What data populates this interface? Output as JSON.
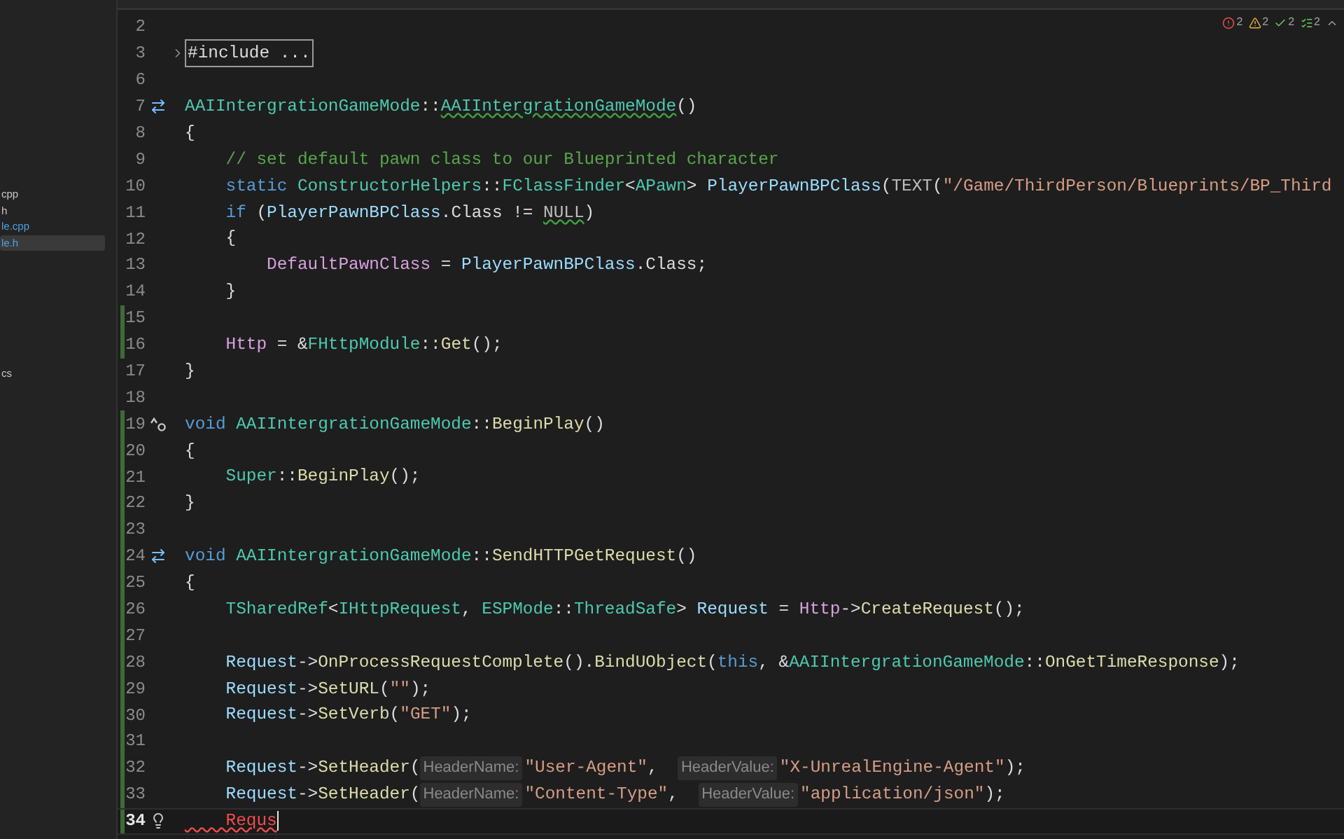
{
  "sidebar": {
    "items": [
      {
        "label": "cpp",
        "selected": false,
        "color": "#c8c8c8"
      },
      {
        "label": "h",
        "selected": false,
        "color": "#c8c8c8"
      },
      {
        "label": "le.cpp",
        "selected": false,
        "color": "#4fa3e0"
      },
      {
        "label": "le.h",
        "selected": true,
        "color": "#4fa3e0"
      }
    ],
    "lower_items": [
      {
        "label": "cs",
        "selected": false,
        "color": "#c8c8c8"
      }
    ]
  },
  "problems": [
    {
      "kind": "error",
      "count": "2"
    },
    {
      "kind": "warning",
      "count": "2"
    },
    {
      "kind": "check",
      "count": "2"
    },
    {
      "kind": "list-check",
      "count": "2"
    }
  ],
  "lines": [
    {
      "number": "2",
      "kind": "plain",
      "changed": false,
      "current": false
    },
    {
      "number": "3",
      "kind": "fold",
      "changed": false,
      "current": false,
      "tokens": [
        {
          "kind": "collapsed",
          "text": "#include ..."
        }
      ]
    },
    {
      "number": "6",
      "kind": "plain",
      "changed": false,
      "current": false
    },
    {
      "number": "7",
      "kind": "override",
      "changed": false,
      "current": false,
      "tokens": [
        {
          "kind": "type",
          "text": "AAIIntergrationGameMode"
        },
        {
          "kind": "plain",
          "text": "::"
        },
        {
          "kind": "type-warning",
          "text": "AAIIntergrationGameMode"
        },
        {
          "kind": "plain",
          "text": "()"
        }
      ]
    },
    {
      "number": "8",
      "kind": "plain",
      "changed": false,
      "current": false,
      "tokens": [
        {
          "kind": "plain",
          "text": "{"
        }
      ]
    },
    {
      "number": "9",
      "kind": "plain",
      "changed": false,
      "current": false,
      "tokens": [
        {
          "kind": "comment",
          "text": "    // set default pawn class to our Blueprinted character"
        }
      ]
    },
    {
      "number": "10",
      "kind": "plain",
      "changed": false,
      "current": false,
      "tokens": [
        {
          "kind": "keyword",
          "text": "    static"
        },
        {
          "kind": "type",
          "text": " ConstructorHelpers"
        },
        {
          "kind": "plain",
          "text": "::"
        },
        {
          "kind": "type",
          "text": "FClassFinder"
        },
        {
          "kind": "plain",
          "text": "<"
        },
        {
          "kind": "type",
          "text": "APawn"
        },
        {
          "kind": "plain",
          "text": "> "
        },
        {
          "kind": "variable",
          "text": "PlayerPawnBPClass"
        },
        {
          "kind": "plain",
          "text": "("
        },
        {
          "kind": "macro",
          "text": "TEXT"
        },
        {
          "kind": "plain",
          "text": "("
        },
        {
          "kind": "string",
          "text": "\"/Game/ThirdPerson/Blueprints/BP_Third"
        }
      ]
    },
    {
      "number": "11",
      "kind": "plain",
      "changed": false,
      "current": false,
      "tokens": [
        {
          "kind": "keyword",
          "text": "    if"
        },
        {
          "kind": "plain",
          "text": " ("
        },
        {
          "kind": "variable",
          "text": "PlayerPawnBPClass"
        },
        {
          "kind": "plain",
          "text": ".Class != "
        },
        {
          "kind": "macro-warning",
          "text": "NULL"
        },
        {
          "kind": "plain",
          "text": ")"
        }
      ]
    },
    {
      "number": "12",
      "kind": "plain",
      "changed": false,
      "current": false,
      "tokens": [
        {
          "kind": "plain",
          "text": "    {"
        }
      ]
    },
    {
      "number": "13",
      "kind": "plain",
      "changed": false,
      "current": false,
      "tokens": [
        {
          "kind": "member",
          "text": "        DefaultPawnClass"
        },
        {
          "kind": "plain",
          "text": " = "
        },
        {
          "kind": "variable",
          "text": "PlayerPawnBPClass"
        },
        {
          "kind": "plain",
          "text": ".Class;"
        }
      ]
    },
    {
      "number": "14",
      "kind": "plain",
      "changed": false,
      "current": false,
      "tokens": [
        {
          "kind": "plain",
          "text": "    }"
        }
      ]
    },
    {
      "number": "15",
      "kind": "plain",
      "changed": true,
      "current": false
    },
    {
      "number": "16",
      "kind": "plain",
      "changed": true,
      "current": false,
      "tokens": [
        {
          "kind": "member",
          "text": "    Http"
        },
        {
          "kind": "plain",
          "text": " = &"
        },
        {
          "kind": "type",
          "text": "FHttpModule"
        },
        {
          "kind": "plain",
          "text": "::"
        },
        {
          "kind": "function",
          "text": "Get"
        },
        {
          "kind": "plain",
          "text": "();"
        }
      ]
    },
    {
      "number": "17",
      "kind": "plain",
      "changed": false,
      "current": false,
      "tokens": [
        {
          "kind": "plain",
          "text": "}"
        }
      ]
    },
    {
      "number": "18",
      "kind": "plain",
      "changed": false,
      "current": false
    },
    {
      "number": "19",
      "kind": "base",
      "changed": true,
      "current": false,
      "tokens": [
        {
          "kind": "keyword",
          "text": "void"
        },
        {
          "kind": "type",
          "text": " AAIIntergrationGameMode"
        },
        {
          "kind": "plain",
          "text": "::"
        },
        {
          "kind": "function",
          "text": "BeginPlay"
        },
        {
          "kind": "plain",
          "text": "()"
        }
      ]
    },
    {
      "number": "20",
      "kind": "plain",
      "changed": true,
      "current": false,
      "tokens": [
        {
          "kind": "plain",
          "text": "{"
        }
      ]
    },
    {
      "number": "21",
      "kind": "plain",
      "changed": true,
      "current": false,
      "tokens": [
        {
          "kind": "type",
          "text": "    Super"
        },
        {
          "kind": "plain",
          "text": "::"
        },
        {
          "kind": "function",
          "text": "BeginPlay"
        },
        {
          "kind": "plain",
          "text": "();"
        }
      ]
    },
    {
      "number": "22",
      "kind": "plain",
      "changed": true,
      "current": false,
      "tokens": [
        {
          "kind": "plain",
          "text": "}"
        }
      ]
    },
    {
      "number": "23",
      "kind": "plain",
      "changed": true,
      "current": false
    },
    {
      "number": "24",
      "kind": "override",
      "changed": true,
      "current": false,
      "tokens": [
        {
          "kind": "keyword",
          "text": "void"
        },
        {
          "kind": "type",
          "text": " AAIIntergrationGameMode"
        },
        {
          "kind": "plain",
          "text": "::"
        },
        {
          "kind": "function",
          "text": "SendHTTPGetRequest"
        },
        {
          "kind": "plain",
          "text": "()"
        }
      ]
    },
    {
      "number": "25",
      "kind": "plain",
      "changed": true,
      "current": false,
      "tokens": [
        {
          "kind": "plain",
          "text": "{"
        }
      ]
    },
    {
      "number": "26",
      "kind": "plain",
      "changed": true,
      "current": false,
      "tokens": [
        {
          "kind": "type",
          "text": "    TSharedRef"
        },
        {
          "kind": "plain",
          "text": "<"
        },
        {
          "kind": "type",
          "text": "IHttpRequest"
        },
        {
          "kind": "plain",
          "text": ", "
        },
        {
          "kind": "type",
          "text": "ESPMode"
        },
        {
          "kind": "plain",
          "text": "::"
        },
        {
          "kind": "type",
          "text": "ThreadSafe"
        },
        {
          "kind": "plain",
          "text": "> "
        },
        {
          "kind": "variable",
          "text": "Request"
        },
        {
          "kind": "plain",
          "text": " = "
        },
        {
          "kind": "member",
          "text": "Http"
        },
        {
          "kind": "plain",
          "text": "->"
        },
        {
          "kind": "function",
          "text": "CreateRequest"
        },
        {
          "kind": "plain",
          "text": "();"
        }
      ]
    },
    {
      "number": "27",
      "kind": "plain",
      "changed": true,
      "current": false
    },
    {
      "number": "28",
      "kind": "plain",
      "changed": true,
      "current": false,
      "tokens": [
        {
          "kind": "variable",
          "text": "    Request"
        },
        {
          "kind": "plain",
          "text": "->"
        },
        {
          "kind": "function",
          "text": "OnProcessRequestComplete"
        },
        {
          "kind": "plain",
          "text": "()."
        },
        {
          "kind": "function",
          "text": "BindUObject"
        },
        {
          "kind": "plain",
          "text": "("
        },
        {
          "kind": "keyword",
          "text": "this"
        },
        {
          "kind": "plain",
          "text": ", &"
        },
        {
          "kind": "type",
          "text": "AAIIntergrationGameMode"
        },
        {
          "kind": "plain",
          "text": "::"
        },
        {
          "kind": "function",
          "text": "OnGetTimeResponse"
        },
        {
          "kind": "plain",
          "text": ");"
        }
      ]
    },
    {
      "number": "29",
      "kind": "plain",
      "changed": true,
      "current": false,
      "tokens": [
        {
          "kind": "variable",
          "text": "    Request"
        },
        {
          "kind": "plain",
          "text": "->"
        },
        {
          "kind": "function",
          "text": "SetURL"
        },
        {
          "kind": "plain",
          "text": "("
        },
        {
          "kind": "string",
          "text": "\"\""
        },
        {
          "kind": "plain",
          "text": ");"
        }
      ]
    },
    {
      "number": "30",
      "kind": "plain",
      "changed": true,
      "current": false,
      "tokens": [
        {
          "kind": "variable",
          "text": "    Request"
        },
        {
          "kind": "plain",
          "text": "->"
        },
        {
          "kind": "function",
          "text": "SetVerb"
        },
        {
          "kind": "plain",
          "text": "("
        },
        {
          "kind": "string",
          "text": "\"GET\""
        },
        {
          "kind": "plain",
          "text": ");"
        }
      ]
    },
    {
      "number": "31",
      "kind": "plain",
      "changed": true,
      "current": false
    },
    {
      "number": "32",
      "kind": "plain",
      "changed": true,
      "current": false,
      "tokens": [
        {
          "kind": "variable",
          "text": "    Request"
        },
        {
          "kind": "plain",
          "text": "->"
        },
        {
          "kind": "function",
          "text": "SetHeader"
        },
        {
          "kind": "plain",
          "text": "("
        },
        {
          "kind": "hint",
          "text": "HeaderName:"
        },
        {
          "kind": "string",
          "text": "\"User-Agent\""
        },
        {
          "kind": "plain",
          "text": ",  "
        },
        {
          "kind": "hint",
          "text": "HeaderValue:"
        },
        {
          "kind": "string",
          "text": "\"X-UnrealEngine-Agent\""
        },
        {
          "kind": "plain",
          "text": ");"
        }
      ]
    },
    {
      "number": "33",
      "kind": "plain",
      "changed": true,
      "current": false,
      "tokens": [
        {
          "kind": "variable",
          "text": "    Request"
        },
        {
          "kind": "plain",
          "text": "->"
        },
        {
          "kind": "function",
          "text": "SetHeader"
        },
        {
          "kind": "plain",
          "text": "("
        },
        {
          "kind": "hint",
          "text": "HeaderName:"
        },
        {
          "kind": "string",
          "text": "\"Content-Type\""
        },
        {
          "kind": "plain",
          "text": ",  "
        },
        {
          "kind": "hint",
          "text": "HeaderValue:"
        },
        {
          "kind": "string",
          "text": "\"application/json\""
        },
        {
          "kind": "plain",
          "text": ");"
        }
      ]
    },
    {
      "number": "34",
      "kind": "lightbulb",
      "changed": true,
      "current": true,
      "tokens": [
        {
          "kind": "error",
          "text": "    Requs"
        }
      ]
    }
  ]
}
